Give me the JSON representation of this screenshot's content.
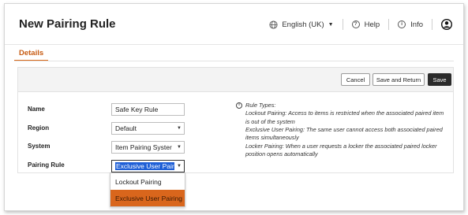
{
  "header": {
    "title": "New Pairing Rule",
    "language_label": "English (UK)",
    "help_label": "Help",
    "info_label": "Info",
    "icons": [
      "globe-icon",
      "help-icon",
      "info-icon",
      "user-icon"
    ]
  },
  "tabs": [
    {
      "label": "Details",
      "active": true
    }
  ],
  "toolbar": {
    "cancel_label": "Cancel",
    "save_return_label": "Save and Return",
    "save_label": "Save"
  },
  "form": {
    "name": {
      "label": "Name",
      "value": "Safe Key Rule"
    },
    "region": {
      "label": "Region",
      "value": "Default"
    },
    "system": {
      "label": "System",
      "value": "Item Pairing Syster"
    },
    "pairing_rule": {
      "label": "Pairing Rule",
      "value": "Exclusive User Pair",
      "options": [
        "Lockout Pairing",
        "Exclusive User Pairing"
      ],
      "highlighted_option": "Exclusive User Pairing"
    }
  },
  "info": {
    "heading": "Rule Types:",
    "lines": [
      "Lockout Pairing: Access to items is restricted when the associated paired item is out of the system",
      "Exclusive User Pairing: The same user cannot access both associated paired items simultaneously",
      "Locker Pairing: When a user requests a locker the associated paired locker position opens automatically"
    ]
  },
  "colors": {
    "accent": "#d9691a",
    "highlight": "#d9661c",
    "selection": "#1f5fd6",
    "save_button": "#2b2b2b"
  }
}
